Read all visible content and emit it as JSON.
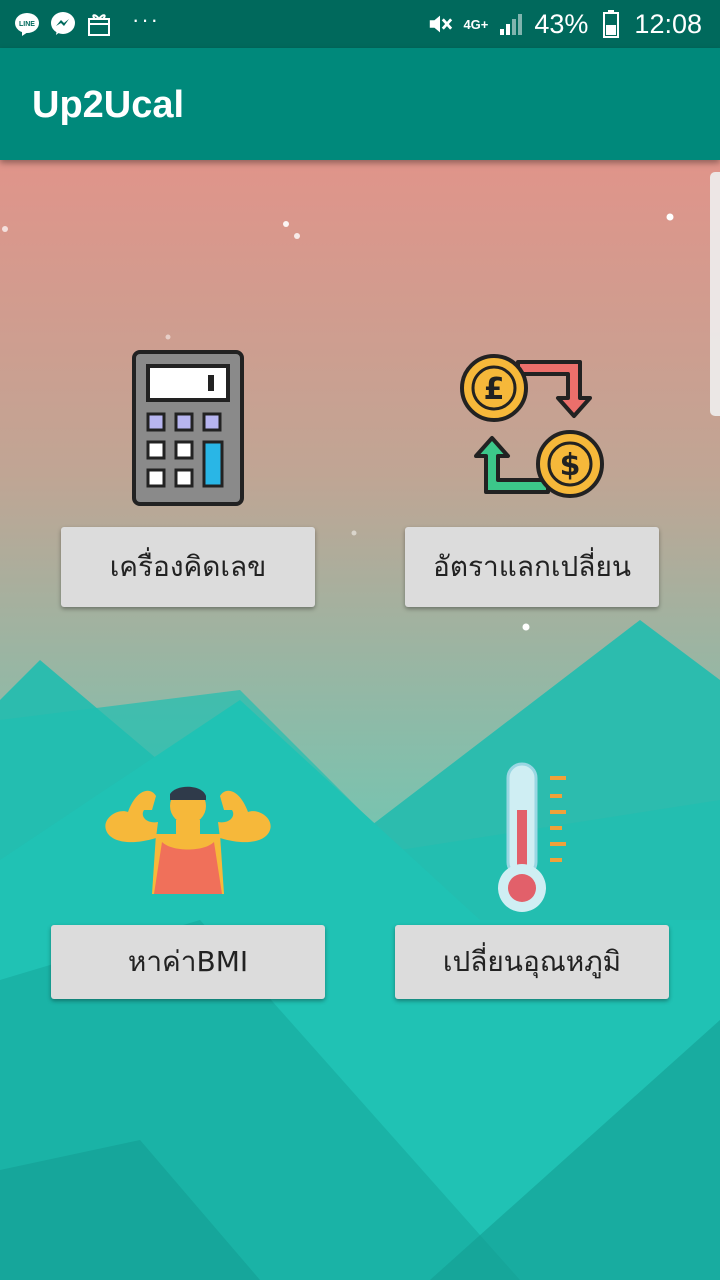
{
  "status_bar": {
    "left_icons": [
      "line-icon",
      "messenger-icon",
      "gift-icon"
    ],
    "more": "···",
    "battery": "43%",
    "time": "12:08",
    "network": "4G+"
  },
  "app_bar": {
    "title": "Up2Ucal"
  },
  "menu": {
    "calculator": {
      "label": "เครื่องคิดเลข",
      "icon": "calculator-icon"
    },
    "exchange": {
      "label": "อัตราแลกเปลี่ยน",
      "icon": "currency-exchange-icon"
    },
    "bmi": {
      "label": "หาค่าBMI",
      "icon": "muscle-man-icon"
    },
    "temperature": {
      "label": "เปลี่ยนอุณหภูมิ",
      "icon": "thermometer-icon"
    }
  },
  "colors": {
    "status_bar": "#00695c",
    "app_bar": "#00897b",
    "sky_top": "#e0948a",
    "sea": "#1fc6b8",
    "button": "#dcdcdc"
  }
}
